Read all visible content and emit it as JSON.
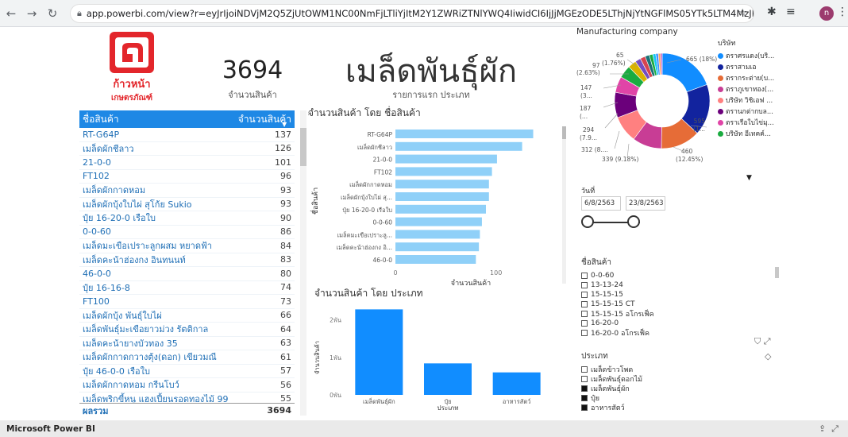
{
  "browser": {
    "url": "app.powerbi.com/view?r=eyJrIjoiNDVjM2Q5ZjUtOWM1NC00NmFjLTliYjItM2Y1ZWRiZTNlYWQ4IiwidCI6IjJjMGEzODE5LThjNjYtNGFlMS05YTk5LTM4MzJkOWZhY2JkOSIsImMiOjEwfQ%3D%3D&page...",
    "profile_initial": "n"
  },
  "report": {
    "logo": {
      "line1": "ก้าวหน้า",
      "line2": "เกษตรภัณฑ์"
    },
    "kpi": {
      "value": "3694",
      "label": "จำนวนสินค้า"
    },
    "title": {
      "text": "เมล็ดพันธุ์ผัก",
      "subtitle": "รายการแรก ประเภท"
    },
    "table": {
      "col1": "ชื่อสินค้า",
      "col2": "จำนวนสินค้า",
      "rows": [
        {
          "name": "RT-G64P",
          "value": "137"
        },
        {
          "name": "เมล็ดผักชีลาว",
          "value": "126"
        },
        {
          "name": "21-0-0",
          "value": "101"
        },
        {
          "name": "FT102",
          "value": "96"
        },
        {
          "name": "เมล็ดผักกาดหอม",
          "value": "93"
        },
        {
          "name": "เมล็ดผักบุ้งใบไผ่ สุโก้ย Sukio",
          "value": "93"
        },
        {
          "name": "ปุ๋ย 16-20-0 เรือใบ",
          "value": "90"
        },
        {
          "name": "0-0-60",
          "value": "86"
        },
        {
          "name": "เมล็ดมะเขือเปราะลูกผสม หยาดฟ้า",
          "value": "84"
        },
        {
          "name": "เมล็ดคะน้าฮ่องกง อินทนนท์",
          "value": "83"
        },
        {
          "name": "46-0-0",
          "value": "80"
        },
        {
          "name": "ปุ๋ย 16-16-8",
          "value": "74"
        },
        {
          "name": "FT100",
          "value": "73"
        },
        {
          "name": "เมล็ดผักบุ้ง พันธุ์ใบไผ่",
          "value": "66"
        },
        {
          "name": "เมล็ดพันธุ์มะเขือยาวม่วง รัตติกาล",
          "value": "64"
        },
        {
          "name": "เมล็ดคะน้ายางบัวทอง 35",
          "value": "63"
        },
        {
          "name": "เมล็ดผักกาดกวางตุ้ง(ดอก) เขียวมณี",
          "value": "61"
        },
        {
          "name": "ปุ๋ย 46-0-0 เรือใบ",
          "value": "57"
        },
        {
          "name": "เมล็ดผักกาดหอม กรีนโบว์",
          "value": "56"
        },
        {
          "name": "เมล็ดพริกขี้หนู แฮงเปี้ยนรอดทองไม้ 99",
          "value": "55"
        }
      ],
      "total_label": "ผลรวม",
      "total_value": "3694"
    },
    "donut": {
      "title": "Manufacturing company",
      "legend_title": "บริษัท",
      "legend": [
        {
          "name": "ตราศรแดง(บริ...",
          "color": "#118DFF"
        },
        {
          "name": "ตราสามเอ",
          "color": "#12239E"
        },
        {
          "name": "ตรากระต่าย(บ...",
          "color": "#E66C37"
        },
        {
          "name": "ตราภูเขาทอง(...",
          "color": "#C83D95"
        },
        {
          "name": "บริษัท วิชิเอฟ ...",
          "color": "#FF8080"
        },
        {
          "name": "ตรานกต่ากบล...",
          "color": "#6B007B"
        },
        {
          "name": "ตราเรือใบไข่มุ...",
          "color": "#E044A7"
        },
        {
          "name": "บริษัท อีเทคค์...",
          "color": "#1AAB40"
        }
      ],
      "labels": {
        "l665": "665 (18%)",
        "l595": "595",
        "l595b": "(1...",
        "l460": "460",
        "l460b": "(12.45%)",
        "l339": "339 (9.18%)",
        "l312": "312 (8....",
        "l294": "294",
        "l294b": "(7.9...",
        "l187": "187",
        "l187b": "(...",
        "l147": "147",
        "l147b": "(3...",
        "l97": "97",
        "l97b": "(2.63%)",
        "l65": "65",
        "l65b": "(1.76%)"
      },
      "segments": [
        {
          "value": 665,
          "color": "#118DFF"
        },
        {
          "value": 595,
          "color": "#12239E"
        },
        {
          "value": 460,
          "color": "#E66C37"
        },
        {
          "value": 339,
          "color": "#C83D95"
        },
        {
          "value": 312,
          "color": "#FF8080"
        },
        {
          "value": 294,
          "color": "#6B007B"
        },
        {
          "value": 187,
          "color": "#E044A7"
        },
        {
          "value": 147,
          "color": "#1AAB40"
        },
        {
          "value": 97,
          "color": "#D9B300"
        },
        {
          "value": 65,
          "color": "#744EC2"
        },
        {
          "value": 60,
          "color": "#D64550"
        },
        {
          "value": 50,
          "color": "#197278"
        },
        {
          "value": 40,
          "color": "#1AAB40"
        },
        {
          "value": 35,
          "color": "#15C6F4"
        },
        {
          "value": 30,
          "color": "#4092FF"
        },
        {
          "value": 25,
          "color": "#FFA058"
        },
        {
          "value": 20,
          "color": "#BE5DC9"
        }
      ]
    },
    "date_slicer": {
      "label": "วันที่",
      "start": "6/8/2563",
      "end": "23/8/2563"
    },
    "product_slicer": {
      "label": "ชื่อสินค้า",
      "items": [
        "0-0-60",
        "13-13-24",
        "15-15-15",
        "15-15-15 CT",
        "15-15-15 อโกรเฟ็ค",
        "16-20-0",
        "16-20-0 อโกรเฟ็ค"
      ]
    },
    "type_slicer": {
      "label": "ประเภท",
      "items": [
        {
          "name": "เมล็ดข้าวโพด",
          "checked": false
        },
        {
          "name": "เมล็ดพันธุ์ดอกไม้",
          "checked": false
        },
        {
          "name": "เมล็ดพันธุ์ผัก",
          "checked": true
        },
        {
          "name": "ปุ๋ย",
          "checked": true
        },
        {
          "name": "อาหารสัตว์",
          "checked": true
        }
      ]
    },
    "chart_data": [
      {
        "type": "bar",
        "orientation": "horizontal",
        "title": "จำนวนสินค้า โดย ชื่อสินค้า",
        "xlabel": "จำนวนสินค้า",
        "ylabel": "ชื่อสินค้า",
        "categories": [
          "RT-G64P",
          "เมล็ดผักชีลาว",
          "21-0-0",
          "FT102",
          "เมล็ดผักกาดหอม",
          "เมล็ดผักบุ้งใบไผ่ สุ...",
          "ปุ๋ย 16-20-0 เรือใบ",
          "0-0-60",
          "เมล็ดมะเขือเปราะลู...",
          "เมล็ดคะน้าฮ่องกง อิ...",
          "46-0-0"
        ],
        "values": [
          137,
          126,
          101,
          96,
          93,
          93,
          90,
          86,
          84,
          83,
          80
        ],
        "xticks": [
          "0",
          "100"
        ],
        "xlim": [
          0,
          150
        ],
        "color": "#8FD0F8"
      },
      {
        "type": "bar",
        "title": "จำนวนสินค้า โดย ประเภท",
        "xlabel": "ประเภท",
        "ylabel": "จำนวนสินค้า",
        "categories": [
          "เมล็ดพันธุ์ผัก",
          "ปุ๋ย",
          "อาหารสัตว์"
        ],
        "values": [
          2280,
          840,
          600
        ],
        "yticks": [
          "0พัน",
          "1พัน",
          "2พัน"
        ],
        "ylim": [
          0,
          2500
        ],
        "color": "#118DFF"
      }
    ]
  },
  "footer": {
    "brand": "Microsoft Power BI"
  }
}
